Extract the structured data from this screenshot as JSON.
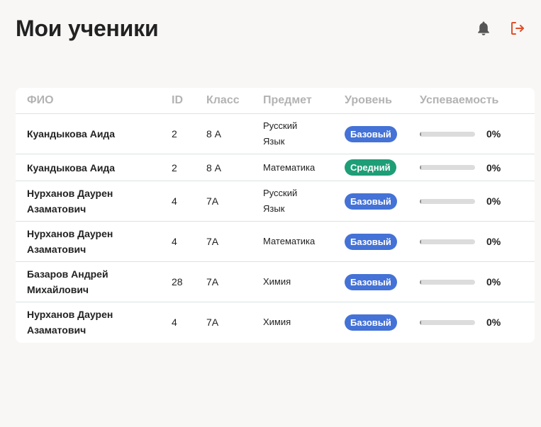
{
  "header": {
    "title": "Мои ученики",
    "bell_icon": "bell-icon",
    "logout_icon": "logout-icon"
  },
  "colors": {
    "badge_basic": "#4472d6",
    "badge_medium": "#1e9e76",
    "logout_accent": "#e0502a",
    "background": "#f9f7f5"
  },
  "table": {
    "columns": [
      "ФИО",
      "ID",
      "Класс",
      "Предмет",
      "Уровень",
      "Успеваемость"
    ],
    "rows": [
      {
        "name_line1": "Куандыкова Аида",
        "name_line2": "",
        "id": "2",
        "class": "8 А",
        "subject_line1": "Русский",
        "subject_line2": "Язык",
        "level": "Базовый",
        "level_color": "#4472d6",
        "progress": 0,
        "progress_text": "0%"
      },
      {
        "name_line1": "Куандыкова Аида",
        "name_line2": "",
        "id": "2",
        "class": "8 А",
        "subject_line1": "Математика",
        "subject_line2": "",
        "level": "Средний",
        "level_color": "#1e9e76",
        "progress": 0,
        "progress_text": "0%"
      },
      {
        "name_line1": "Нурханов Даурен",
        "name_line2": "Азаматович",
        "id": "4",
        "class": "7А",
        "subject_line1": "Русский",
        "subject_line2": "Язык",
        "level": "Базовый",
        "level_color": "#4472d6",
        "progress": 0,
        "progress_text": "0%"
      },
      {
        "name_line1": "Нурханов Даурен",
        "name_line2": "Азаматович",
        "id": "4",
        "class": "7А",
        "subject_line1": "Математика",
        "subject_line2": "",
        "level": "Базовый",
        "level_color": "#4472d6",
        "progress": 0,
        "progress_text": "0%"
      },
      {
        "name_line1": "Базаров Андрей",
        "name_line2": "Михайлович",
        "id": "28",
        "class": "7А",
        "subject_line1": "Химия",
        "subject_line2": "",
        "level": "Базовый",
        "level_color": "#4472d6",
        "progress": 0,
        "progress_text": "0%"
      },
      {
        "name_line1": "Нурханов Даурен",
        "name_line2": "Азаматович",
        "id": "4",
        "class": "7А",
        "subject_line1": "Химия",
        "subject_line2": "",
        "level": "Базовый",
        "level_color": "#4472d6",
        "progress": 0,
        "progress_text": "0%"
      }
    ]
  }
}
